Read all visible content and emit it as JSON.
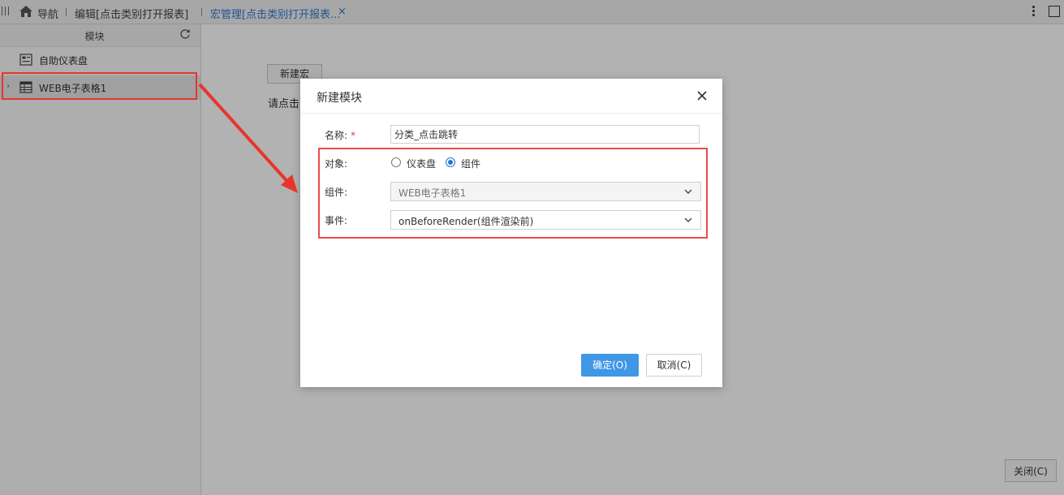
{
  "topbar": {
    "nav_label": "导航",
    "tab_edit": "编辑[点击类别打开报表]",
    "tab_macro": "宏管理[点击类别打开报表...",
    "tab_close": "×"
  },
  "left_panel": {
    "title": "模块",
    "items": [
      {
        "label": "自助仪表盘",
        "icon": "dashboard-icon"
      },
      {
        "label": "WEB电子表格1",
        "icon": "spreadsheet-icon"
      }
    ],
    "expand_arrow": "›"
  },
  "main": {
    "new_macro_label": "新建宏",
    "hint": "请点击",
    "close_label": "关闭(C)"
  },
  "dialog": {
    "title": "新建模块",
    "name_label": "名称:",
    "required_mark": "*",
    "name_value": "分类_点击跳转",
    "object_label": "对象:",
    "radio_dashboard": "仪表盘",
    "radio_component": "组件",
    "selected_object": "组件",
    "component_label": "组件:",
    "component_value": "WEB电子表格1",
    "event_label": "事件:",
    "event_value": "onBeforeRender(组件渲染前)",
    "ok_label": "确定(O)",
    "cancel_label": "取消(C)"
  },
  "colors": {
    "accent": "#3f97e6",
    "tab_active": "#2e7bd0",
    "annotation": "#e8352c",
    "highlight": "#e84c4c"
  }
}
